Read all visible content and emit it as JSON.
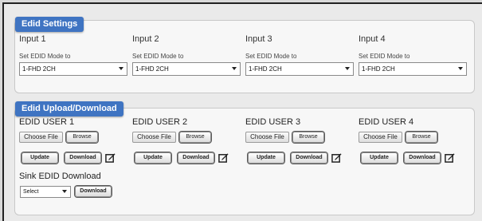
{
  "edid_settings": {
    "title": "Edid Settings",
    "inputs": [
      {
        "title": "Input 1",
        "mode_label": "Set EDID Mode to",
        "value": "1-FHD 2CH"
      },
      {
        "title": "Input 2",
        "mode_label": "Set EDID Mode to",
        "value": "1-FHD 2CH"
      },
      {
        "title": "Input 3",
        "mode_label": "Set EDID Mode to",
        "value": "1-FHD 2CH"
      },
      {
        "title": "Input 4",
        "mode_label": "Set EDID Mode to",
        "value": "1-FHD 2CH"
      }
    ]
  },
  "edid_upload": {
    "title": "Edid Upload/Download",
    "users": [
      {
        "title": "EDID USER 1",
        "choose_label": "Choose File",
        "browse_label": "Browse",
        "update_label": "Update",
        "download_label": "Download"
      },
      {
        "title": "EDID USER 2",
        "choose_label": "Choose File",
        "browse_label": "Browse",
        "update_label": "Update",
        "download_label": "Download"
      },
      {
        "title": "EDID USER 3",
        "choose_label": "Choose File",
        "browse_label": "Browse",
        "update_label": "Update",
        "download_label": "Download"
      },
      {
        "title": "EDID USER 4",
        "choose_label": "Choose File",
        "browse_label": "Browse",
        "update_label": "Update",
        "download_label": "Download"
      }
    ],
    "sink": {
      "title": "Sink EDID Download",
      "select_value": "Select",
      "download_label": "Download"
    }
  },
  "icons": {
    "edit": "edit-icon",
    "dropdown": "chevron-down-icon"
  },
  "colors": {
    "tab_bg": "#3f74c2",
    "panel_bg": "#f7f7f7",
    "page_bg": "#eaeaea"
  }
}
